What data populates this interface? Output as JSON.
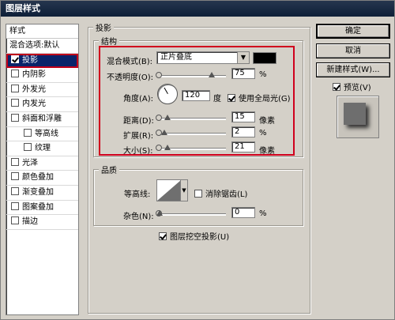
{
  "window": {
    "title": "图层样式"
  },
  "styles_panel": {
    "header": "样式",
    "blend_default": "混合选项:默认",
    "items": [
      {
        "label": "投影",
        "checked": true,
        "selected": true
      },
      {
        "label": "内阴影",
        "checked": false
      },
      {
        "label": "外发光",
        "checked": false
      },
      {
        "label": "内发光",
        "checked": false
      },
      {
        "label": "斜面和浮雕",
        "checked": false
      },
      {
        "label": "等高线",
        "checked": false,
        "sub": true
      },
      {
        "label": "纹理",
        "checked": false,
        "sub": true
      },
      {
        "label": "光泽",
        "checked": false
      },
      {
        "label": "颜色叠加",
        "checked": false
      },
      {
        "label": "渐变叠加",
        "checked": false
      },
      {
        "label": "图案叠加",
        "checked": false
      },
      {
        "label": "描边",
        "checked": false
      }
    ]
  },
  "drop_shadow": {
    "section_title": "投影",
    "structure": {
      "title": "结构",
      "blend_mode_label": "混合模式(B):",
      "blend_mode_value": "正片叠底",
      "shadow_color": "#000000",
      "opacity_label": "不透明度(O):",
      "opacity_value": "75",
      "opacity_unit": "%",
      "opacity_fraction": 0.75,
      "angle_label": "角度(A):",
      "angle_value": "120",
      "angle_unit": "度",
      "global_light_label": "使用全局光(G)",
      "global_light_checked": true,
      "distance_label": "距离(D):",
      "distance_value": "15",
      "distance_unit": "像素",
      "distance_fraction": 0.05,
      "spread_label": "扩展(R):",
      "spread_value": "2",
      "spread_unit": "%",
      "spread_fraction": 0.02,
      "size_label": "大小(S):",
      "size_value": "21",
      "size_unit": "像素",
      "size_fraction": 0.05
    },
    "quality": {
      "title": "品质",
      "contour_label": "等高线:",
      "antialias_label": "消除锯齿(L)",
      "antialias_checked": false,
      "noise_label": "杂色(N):",
      "noise_value": "0",
      "noise_unit": "%",
      "noise_fraction": 0
    },
    "knockout_label": "图层挖空投影(U)",
    "knockout_checked": true
  },
  "buttons": {
    "ok": "确定",
    "cancel": "取消",
    "new_style": "新建样式(W)..."
  },
  "preview": {
    "label": "预览(V)",
    "checked": true
  },
  "colors": {
    "highlight_red": "#d0001d",
    "selection_blue": "#0a246a"
  }
}
